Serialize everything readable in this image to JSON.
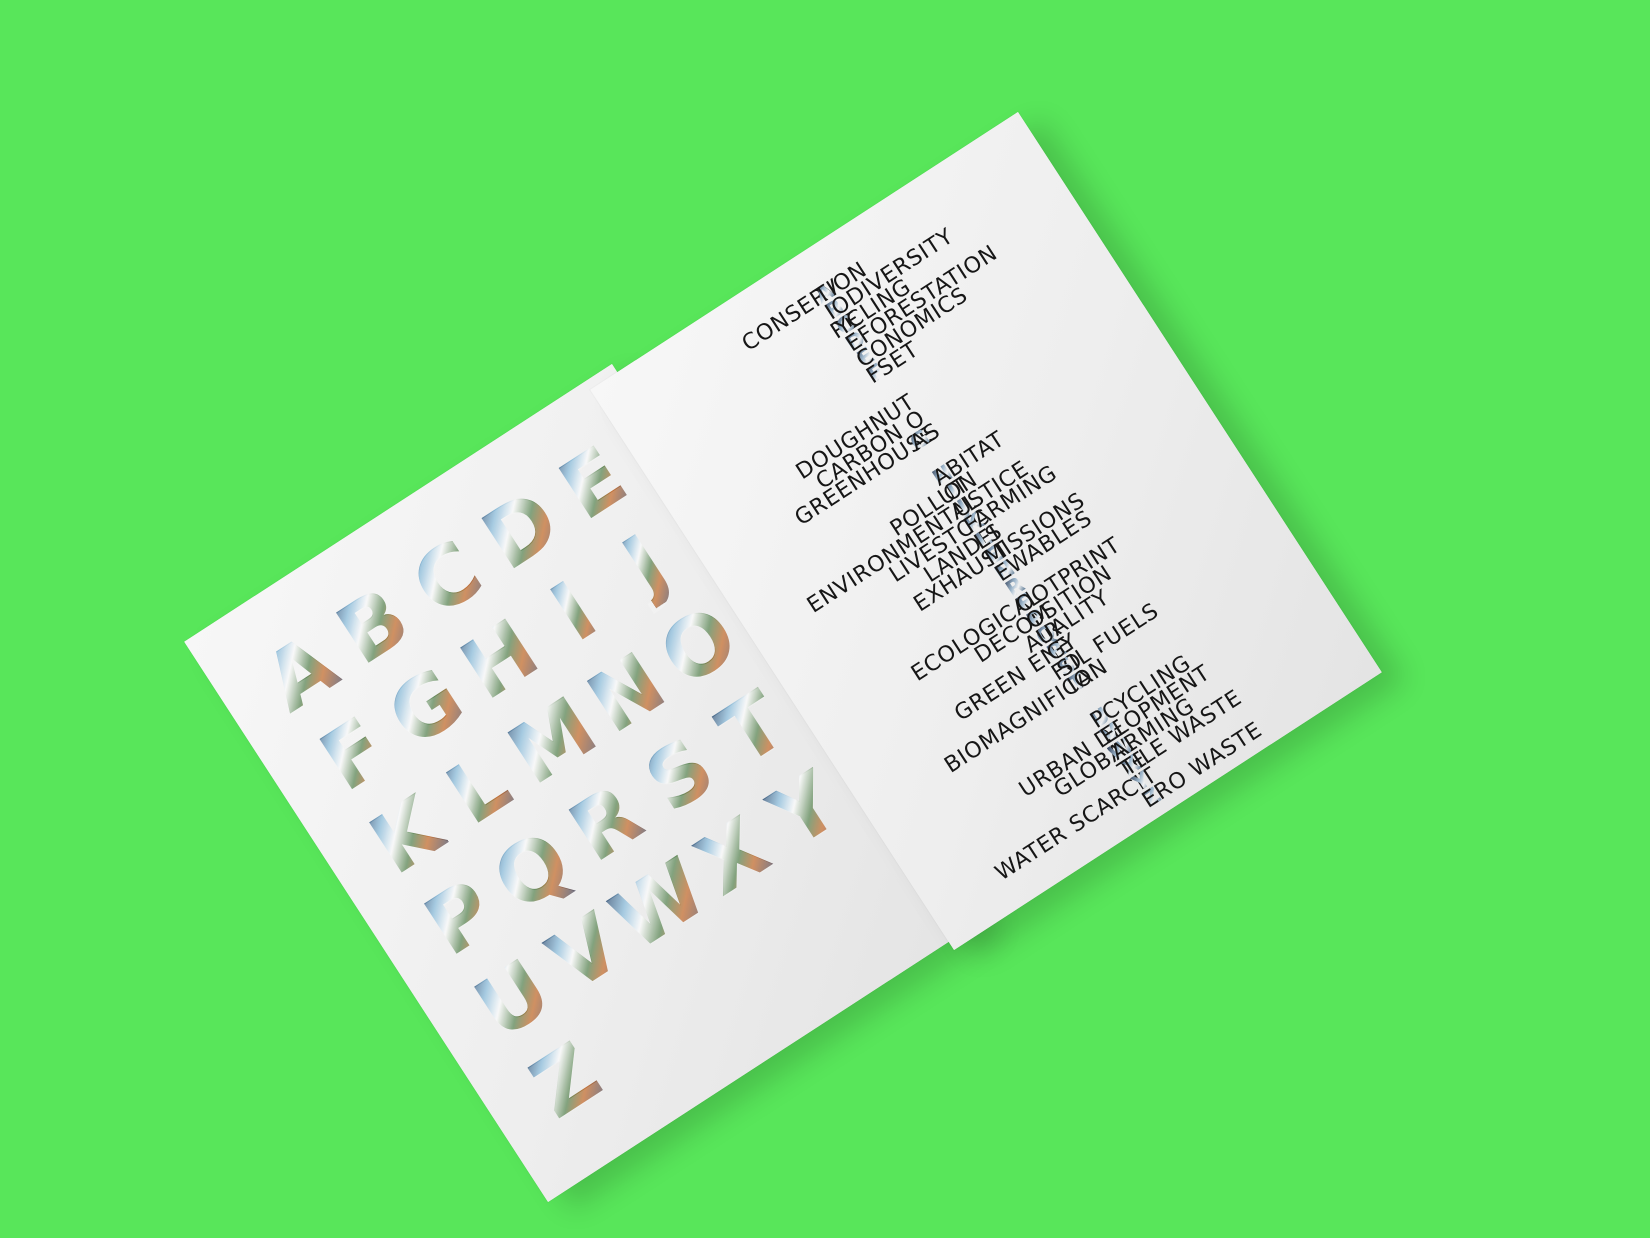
{
  "scene": {
    "background_color": "#58e65a",
    "paper_color": "#f1f1f1"
  },
  "left_sheet": {
    "letters": [
      "A",
      "B",
      "C",
      "D",
      "E",
      "F",
      "G",
      "H",
      "I",
      "J",
      "K",
      "L",
      "M",
      "N",
      "O",
      "P",
      "Q",
      "R",
      "S",
      "T",
      "U",
      "V",
      "W",
      "X",
      "Y",
      "Z"
    ]
  },
  "right_sheet": {
    "rows": [
      {
        "left": "CONSERV",
        "marker": "A",
        "right": "TION"
      },
      {
        "left": "",
        "marker": "B",
        "right": "IODIVERSITY"
      },
      {
        "left": "RE",
        "marker": "C",
        "right": "YCLING"
      },
      {
        "left": "",
        "marker": "D",
        "right": "EFORESTATION"
      },
      {
        "left": "",
        "marker": "E",
        "right": "CONOMICS"
      },
      {
        "left": "",
        "marker": "F",
        "right": "FSET"
      },
      {
        "left": "DOUGHNUT",
        "marker": "",
        "right": ""
      },
      {
        "left": "CARBON O",
        "marker": "",
        "right": ""
      },
      {
        "left": "GREENHOUSE",
        "marker": "G",
        "right": "AS"
      },
      {
        "left": "",
        "marker": "H",
        "right": "ABITAT"
      },
      {
        "left": "POLLUT",
        "marker": "I",
        "right": "ON"
      },
      {
        "left": "ENVIRONMENTAL",
        "marker": "J",
        "right": "USTICE"
      },
      {
        "left": "LIVESTOC",
        "marker": "K",
        "right": "FARMING"
      },
      {
        "left": "LANDFI",
        "marker": "L",
        "right": "LS"
      },
      {
        "left": "EXHAUST",
        "marker": "E",
        "right": "MISSIONS"
      },
      {
        "left": "",
        "marker": "N",
        "right": "EWABLES"
      },
      {
        "left": "",
        "marker": "R",
        "right": ""
      },
      {
        "left": "ECOLOGICAL",
        "marker": "F",
        "right": "OOTPRINT"
      },
      {
        "left": "DECOM",
        "marker": "P",
        "right": "OSITION"
      },
      {
        "left": "AIR",
        "marker": "Q",
        "right": "UALITY"
      },
      {
        "left": "GREEN ENE",
        "marker": "R",
        "right": "GY"
      },
      {
        "left": "FO",
        "marker": "S",
        "right": "SIL FUELS"
      },
      {
        "left": "BIOMAGNIFICA",
        "marker": "T",
        "right": "ION"
      },
      {
        "left": "",
        "marker": "U",
        "right": "PCYCLING"
      },
      {
        "left": "URBAN DE",
        "marker": "V",
        "right": "ELOPMENT"
      },
      {
        "left": "GLOBAL",
        "marker": "W",
        "right": "ARMING"
      },
      {
        "left": "TE",
        "marker": "X",
        "right": "TILE WASTE"
      },
      {
        "left": "WATER SCARCIT",
        "marker": "Y",
        "right": ""
      },
      {
        "left": "",
        "marker": "Z",
        "right": "ERO WASTE"
      }
    ]
  }
}
